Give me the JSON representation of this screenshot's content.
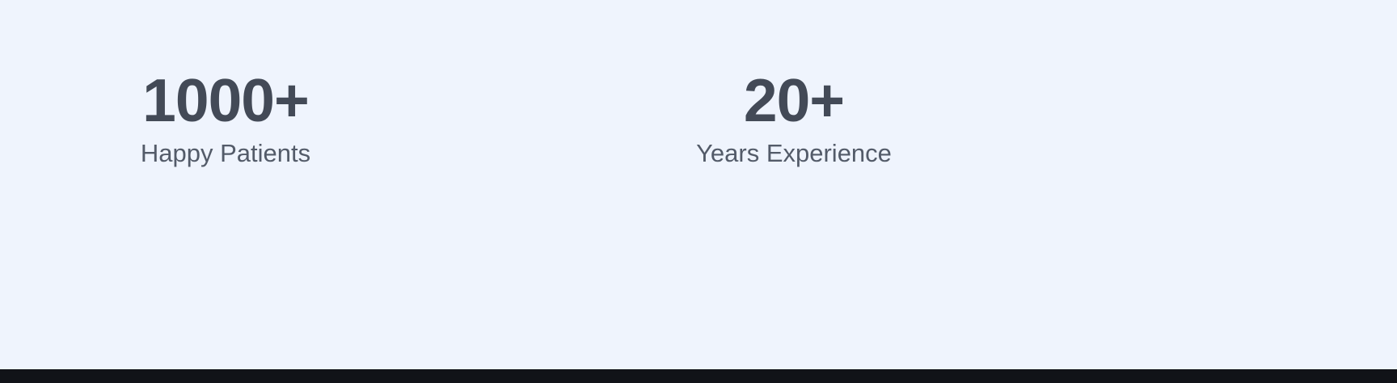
{
  "stats": [
    {
      "value": "1000+",
      "label": "Happy Patients"
    },
    {
      "value": "20+",
      "label": "Years Experience"
    }
  ],
  "colors": {
    "section_background": "#eff4fd",
    "value_text": "#434a57",
    "label_text": "#535b69",
    "footer_background": "#111318"
  }
}
